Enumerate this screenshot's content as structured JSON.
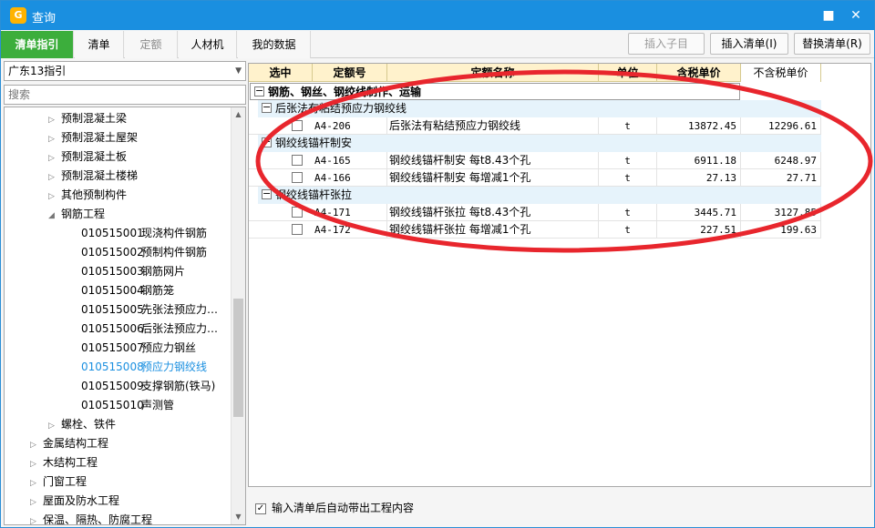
{
  "window": {
    "title": "查询",
    "icon_label": "G"
  },
  "tabs": [
    {
      "label": "清单指引"
    },
    {
      "label": "清单"
    },
    {
      "label": "定额"
    },
    {
      "label": "人材机"
    },
    {
      "label": "我的数据"
    }
  ],
  "toolbar": {
    "insert_child": "插入子目",
    "insert_list": "插入清单(I)",
    "replace_list": "替换清单(R)"
  },
  "left": {
    "combo_value": "广东13指引",
    "search_placeholder": "搜索",
    "tree": [
      {
        "label": "预制混凝土梁",
        "code": ""
      },
      {
        "label": "预制混凝土屋架",
        "code": ""
      },
      {
        "label": "预制混凝土板",
        "code": ""
      },
      {
        "label": "预制混凝土楼梯",
        "code": ""
      },
      {
        "label": "其他预制构件",
        "code": ""
      },
      {
        "label": "钢筋工程",
        "code": ""
      },
      {
        "label": "现浇构件钢筋",
        "code": "010515001"
      },
      {
        "label": "预制构件钢筋",
        "code": "010515002"
      },
      {
        "label": "钢筋网片",
        "code": "010515003"
      },
      {
        "label": "钢筋笼",
        "code": "010515004"
      },
      {
        "label": "先张法预应力…",
        "code": "010515005"
      },
      {
        "label": "后张法预应力…",
        "code": "010515006"
      },
      {
        "label": "预应力钢丝",
        "code": "010515007"
      },
      {
        "label": "预应力钢绞线",
        "code": "010515008"
      },
      {
        "label": "支撑钢筋(铁马)",
        "code": "010515009"
      },
      {
        "label": "声测管",
        "code": "010515010"
      },
      {
        "label": "螺栓、铁件",
        "code": ""
      },
      {
        "label": "金属结构工程",
        "code": ""
      },
      {
        "label": "木结构工程",
        "code": ""
      },
      {
        "label": "门窗工程",
        "code": ""
      },
      {
        "label": "屋面及防水工程",
        "code": ""
      },
      {
        "label": "保温、隔热、防腐工程",
        "code": ""
      }
    ]
  },
  "grid": {
    "headers": [
      "选中",
      "定额号",
      "定额名称",
      "单位",
      "含税单价",
      "不含税单价"
    ],
    "group_l1": "钢筋、钢丝、钢绞线制作、运输",
    "groups": [
      {
        "label": "后张法有粘结预应力钢绞线",
        "rows": [
          {
            "code": "A4-206",
            "name": "后张法有粘结预应力钢绞线",
            "unit": "t",
            "price_tax": "13872.45",
            "price_notax": "12296.61"
          }
        ]
      },
      {
        "label": "钢绞线锚杆制安",
        "rows": [
          {
            "code": "A4-165",
            "name": "钢绞线锚杆制安 每t8.43个孔",
            "unit": "t",
            "price_tax": "6911.18",
            "price_notax": "6248.97"
          },
          {
            "code": "A4-166",
            "name": "钢绞线锚杆制安 每增减1个孔",
            "unit": "t",
            "price_tax": "27.13",
            "price_notax": "27.71"
          }
        ]
      },
      {
        "label": "钢绞线锚杆张拉",
        "rows": [
          {
            "code": "A4-171",
            "name": "钢绞线锚杆张拉 每t8.43个孔",
            "unit": "t",
            "price_tax": "3445.71",
            "price_notax": "3127.85"
          },
          {
            "code": "A4-172",
            "name": "钢绞线锚杆张拉 每增减1个孔",
            "unit": "t",
            "price_tax": "227.51",
            "price_notax": "199.63"
          }
        ]
      }
    ]
  },
  "footer": {
    "auto_content_label": "输入清单后自动带出工程内容"
  },
  "colors": {
    "title_bar": "#1a8fe0",
    "active_tab": "#3cae3c",
    "header_bg": "#fff2cc",
    "group_bg": "#e6f3fb",
    "selected_text": "#1a8fe0",
    "annotation": "#e8262d"
  }
}
